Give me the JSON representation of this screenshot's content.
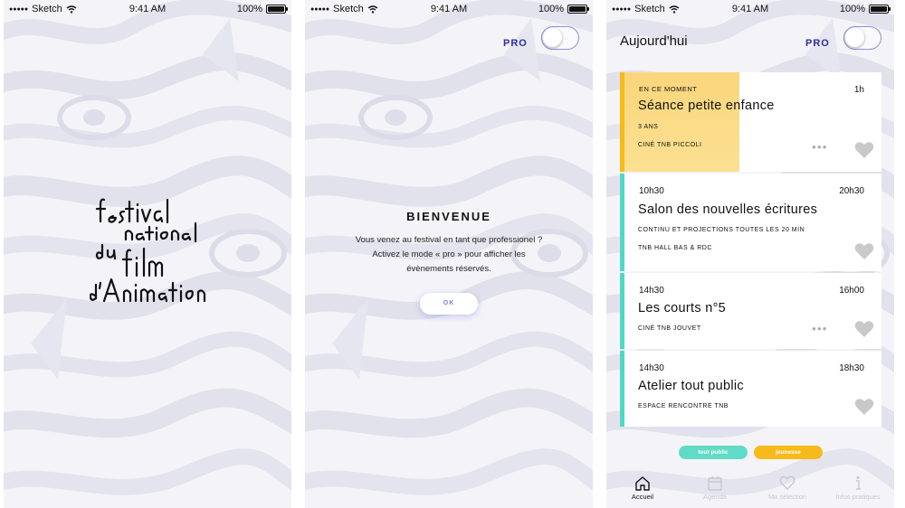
{
  "status_bar": {
    "carrier": "Sketch",
    "time": "9:41 AM",
    "battery": "100%"
  },
  "welcome": {
    "pro_label": "PRO",
    "title": "BIENVENUE",
    "body": "Vous venez au festival en tant que professionel ? Activez le mode « pro » pour afficher les évènements réservés.",
    "ok_label": "OK"
  },
  "agenda": {
    "title": "Aujourd'hui",
    "pro_label": "PRO",
    "events": [
      {
        "start": "EN CE MOMENT",
        "end": "1h",
        "title": "Séance petite enfance",
        "age": "3 ANS",
        "venue": "CINÉ TNB PICCOLI",
        "category": "jeunesse",
        "color": "#f7ba1a"
      },
      {
        "start": "10h30",
        "end": "20h30",
        "title": "Salon des nouvelles écritures",
        "detail": "CONTINU ET PROJECTIONS TOUTES LES 20 MIN",
        "venue": "TNB HALL BAS & RDC",
        "category": "tout public",
        "color": "#4fd8c4"
      },
      {
        "start": "14h30",
        "end": "16h00",
        "title": "Les courts n°5",
        "venue": "CINÉ TNB JOUVET",
        "category": "tout public",
        "color": "#4fd8c4"
      },
      {
        "start": "14h30",
        "end": "18h30",
        "title": "Atelier tout public",
        "venue": "ESPACE RENCONTRE TNB",
        "category": "tout public",
        "color": "#4fd8c4"
      }
    ],
    "legend": [
      {
        "label": "tout public",
        "color": "#5fdbc7"
      },
      {
        "label": "jeunesse",
        "color": "#f7ba1a"
      }
    ],
    "tabs": [
      {
        "label": "Accueil",
        "icon": "home-icon",
        "active": true
      },
      {
        "label": "Agenda",
        "icon": "calendar-icon",
        "active": false
      },
      {
        "label": "Ma sélection",
        "icon": "heart-icon",
        "active": false
      },
      {
        "label": "Infos pratiques",
        "icon": "info-icon",
        "active": false
      }
    ]
  }
}
